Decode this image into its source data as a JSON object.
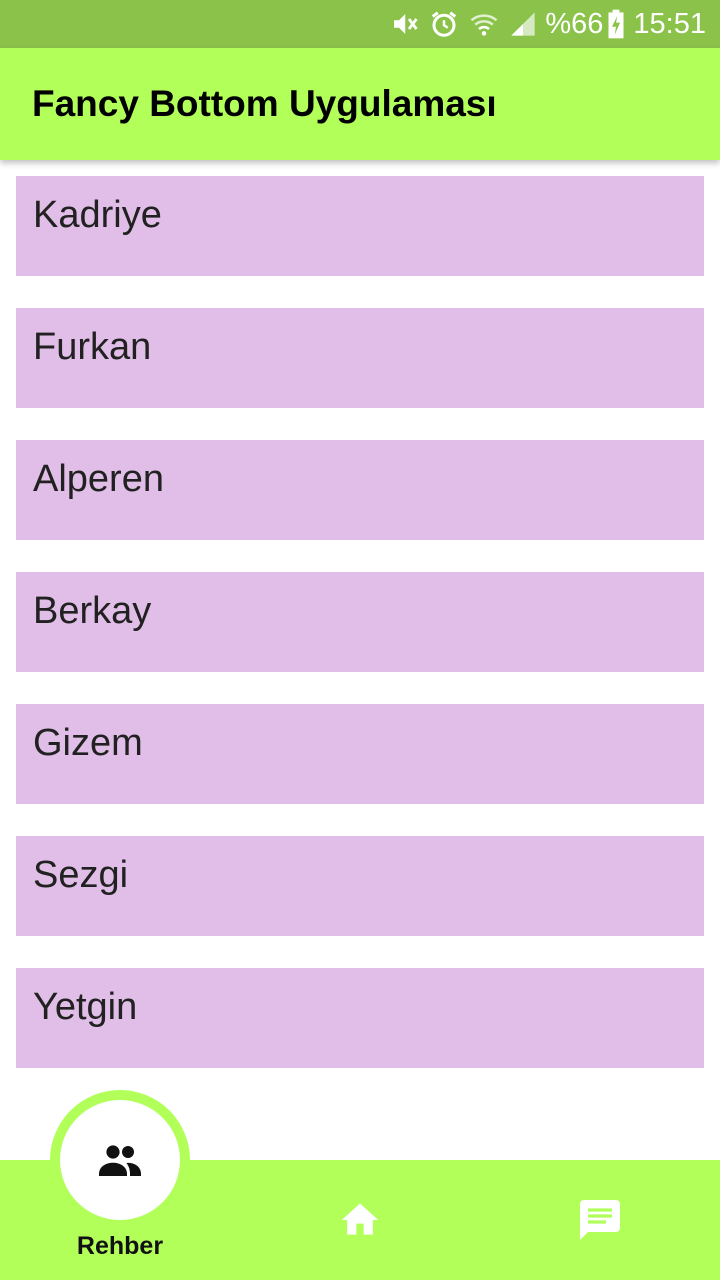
{
  "status_bar": {
    "battery_percent": "%66",
    "time": "15:51",
    "icons": [
      "mute-icon",
      "alarm-icon",
      "wifi-icon",
      "signal-icon",
      "battery-charging-icon"
    ]
  },
  "app_bar": {
    "title": "Fancy Bottom Uygulaması"
  },
  "list": {
    "items": [
      "Kadriye",
      "Furkan",
      "Alperen",
      "Berkay",
      "Gizem",
      "Sezgi",
      "Yetgin"
    ]
  },
  "bottom_nav": {
    "active_label": "Rehber",
    "items": [
      {
        "icon": "people-icon",
        "label": "Rehber",
        "active": true
      },
      {
        "icon": "home-icon",
        "active": false
      },
      {
        "icon": "message-icon",
        "active": false
      }
    ]
  },
  "colors": {
    "status_bar": "#8bc34a",
    "app_bar": "#b2ff59",
    "list_item": "#e1bee7",
    "text": "#212121"
  }
}
